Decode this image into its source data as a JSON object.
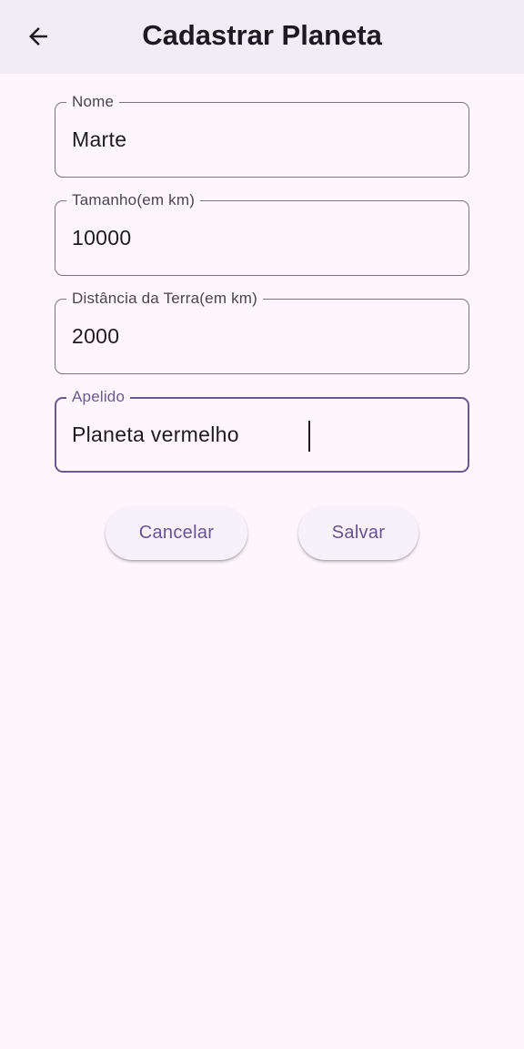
{
  "app_bar": {
    "title": "Cadastrar Planeta",
    "back_icon": "arrow-back-icon"
  },
  "form": {
    "fields": [
      {
        "label": "Nome",
        "value": "Marte"
      },
      {
        "label": "Tamanho(em km)",
        "value": "10000"
      },
      {
        "label": "Distância da Terra(em km)",
        "value": "2000"
      },
      {
        "label": "Apelido",
        "value": "Planeta vermelho",
        "focused": true
      }
    ]
  },
  "actions": {
    "cancel_label": "Cancelar",
    "save_label": "Salvar"
  },
  "colors": {
    "background": "#fdf7fd",
    "app_bar": "#f2ecf4",
    "accent": "#6b5890",
    "button_text": "#65558f",
    "outline": "#79747e"
  }
}
